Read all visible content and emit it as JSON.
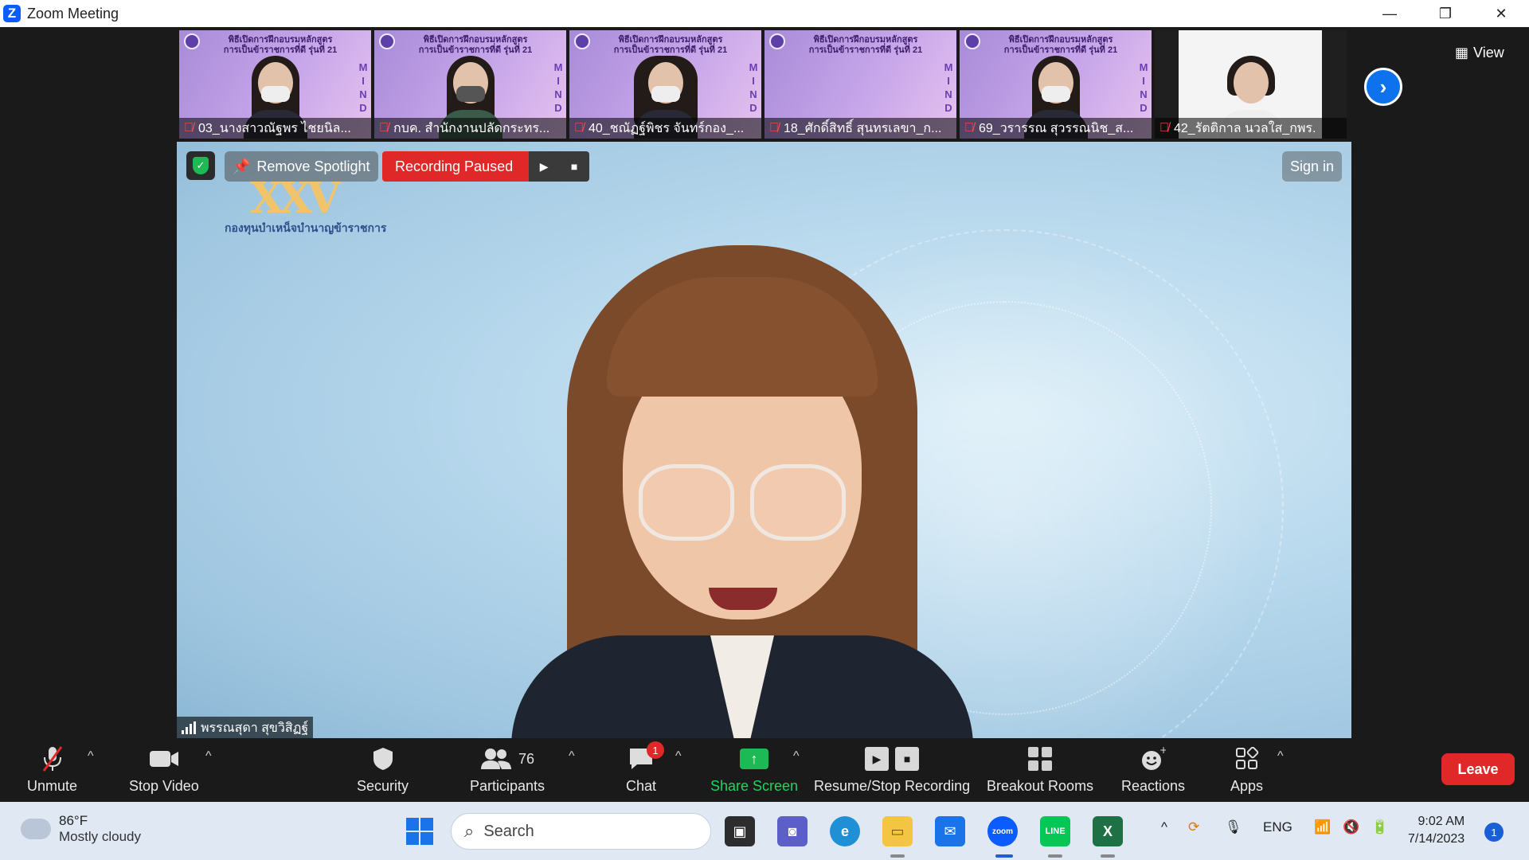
{
  "window": {
    "title": "Zoom Meeting",
    "controls": [
      "—",
      "❐",
      "✕"
    ]
  },
  "participants_strip": [
    {
      "name": "03_นางสาวณัฐพร ไชยนิล...",
      "muted": true,
      "banner": "พิธีเปิดการฝึกอบรมหลักสูตร การเป็นข้าราชการที่ดี รุ่นที่ 21"
    },
    {
      "name": "กบค. สำนักงานปลัดกระทร...",
      "muted": true,
      "banner": "พิธีเปิดการฝึกอบรมหลักสูตร การเป็นข้าราชการที่ดี รุ่นที่ 21"
    },
    {
      "name": "40_ชณัฏฐ์พิชร จันทร์กอง_...",
      "muted": true,
      "banner": "พิธีเปิดการฝึกอบรมหลักสูตร การเป็นข้าราชการที่ดี รุ่นที่ 21"
    },
    {
      "name": "18_ศักดิ์สิทธิ์ สุนทรเลขา_ก...",
      "muted": true,
      "banner": "พิธีเปิดการฝึกอบรมหลักสูตร การเป็นข้าราชการที่ดี รุ่นที่ 21"
    },
    {
      "name": "69_วรารรณ สุวรรณนิช_ส...",
      "muted": true,
      "banner": "พิธีเปิดการฝึกอบรมหลักสูตร การเป็นข้าราชการที่ดี รุ่นที่ 21"
    },
    {
      "name": "42_รัตติกาล นวลใส_กพร.",
      "muted": true,
      "banner": ""
    }
  ],
  "mind_letters": "M I N D",
  "view_button": "View",
  "main_video": {
    "logo_text": "XXV",
    "logo_org": "กองทุนบำเหน็จบำนาญข้าราชการ",
    "remove_spotlight": "Remove Spotlight",
    "recording_status": "Recording Paused",
    "sign_in": "Sign in",
    "speaker_name": "พรรณสุดา สุขวิสิฏฐ์"
  },
  "toolbar": {
    "unmute": "Unmute",
    "stop_video": "Stop Video",
    "security": "Security",
    "participants": "Participants",
    "participants_count": "76",
    "chat": "Chat",
    "chat_badge": "1",
    "share_screen": "Share Screen",
    "recording": "Resume/Stop Recording",
    "breakout_rooms": "Breakout Rooms",
    "reactions": "Reactions",
    "apps": "Apps",
    "leave": "Leave"
  },
  "taskbar": {
    "weather_temp": "86°F",
    "weather_condition": "Mostly cloudy",
    "search_placeholder": "Search",
    "language": "ENG",
    "time": "9:02 AM",
    "date": "7/14/2023",
    "notification_count": "1"
  },
  "colors": {
    "zoom_blue": "#0b5cff",
    "record_red": "#e02828",
    "share_green": "#1cb954",
    "leave_red": "#e02828"
  }
}
